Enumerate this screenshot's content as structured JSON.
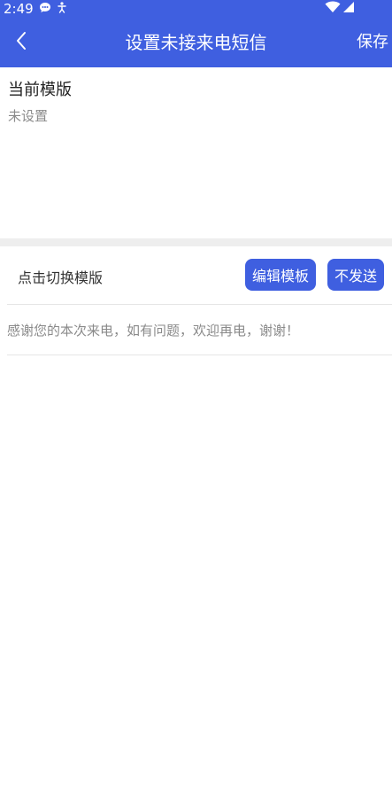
{
  "status_bar": {
    "time": "2:49"
  },
  "app_bar": {
    "title": "设置未接来电短信",
    "save_label": "保存"
  },
  "current_template": {
    "title": "当前模版",
    "value": "未设置"
  },
  "switch_row": {
    "label": "点击切换模版",
    "edit_button": "编辑模板",
    "no_send_button": "不发送"
  },
  "template_list": [
    {
      "text": "感谢您的本次来电，如有问题，欢迎再电，谢谢！"
    }
  ],
  "colors": {
    "accent": "#3f5fe0",
    "muted_text": "#8a8a8a",
    "divider": "#eeeeee"
  },
  "icons": {
    "back": "chevron-left-icon",
    "wifi": "wifi-icon",
    "signal": "signal-icon",
    "chat_notification": "chat-bubble-icon",
    "accessibility": "accessibility-icon"
  }
}
